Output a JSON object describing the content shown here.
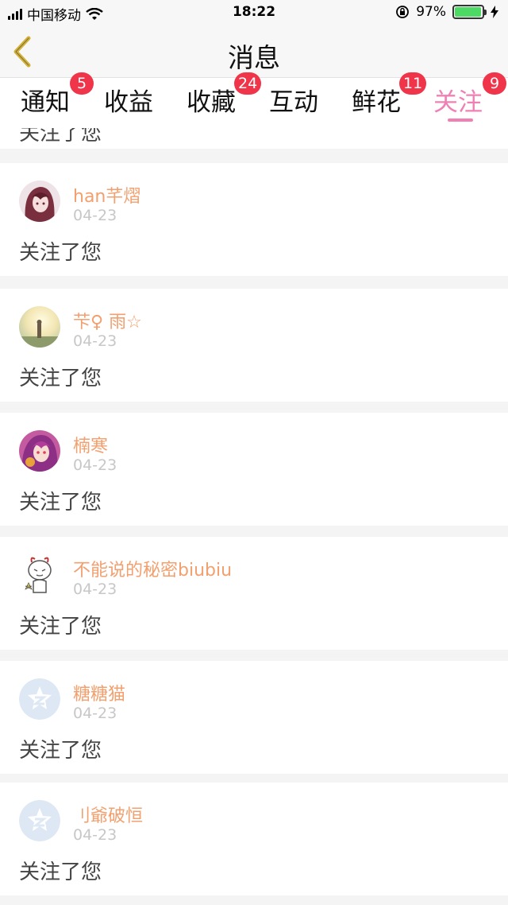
{
  "status_bar": {
    "carrier": "中国移动",
    "time": "18:22",
    "battery_percent": "97%",
    "battery_level": 0.97,
    "icons": [
      "signal-icon",
      "wifi-icon",
      "rotation-lock-icon",
      "battery-icon",
      "charging-icon"
    ]
  },
  "nav": {
    "title": "消息",
    "back_icon": "chevron-left-icon",
    "back_color": "#d4b23a"
  },
  "tabs": [
    {
      "label": "通知",
      "badge": "5"
    },
    {
      "label": "收益",
      "badge": ""
    },
    {
      "label": "收藏",
      "badge": "24"
    },
    {
      "label": "互动",
      "badge": ""
    },
    {
      "label": "鲜花",
      "badge": "11"
    },
    {
      "label": "关注",
      "badge": "9",
      "active": true
    }
  ],
  "colors": {
    "accent": "#f080b4",
    "badge": "#f0354b",
    "username": "#f2a06f",
    "date": "#c7c7c7"
  },
  "partial_item": {
    "text": "关注了您"
  },
  "items": [
    {
      "name": "han芊熠",
      "date": "04-23",
      "text": "关注了您",
      "avatar": "anime-girl-avatar"
    },
    {
      "name": "芐♀ 雨☆",
      "date": "04-23",
      "text": "关注了您",
      "avatar": "sunset-avatar"
    },
    {
      "name": "楠寒",
      "date": "04-23",
      "text": "关注了您",
      "avatar": "anime-purple-avatar"
    },
    {
      "name": "不能说的秘密biubiu",
      "date": "04-23",
      "text": "关注了您",
      "avatar": "cartoon-bunny-avatar"
    },
    {
      "name": "糖糖猫",
      "date": "04-23",
      "text": "关注了您",
      "avatar": "default-avatar"
    },
    {
      "name": "刂爺破恒",
      "date": "04-23",
      "text": "关注了您",
      "avatar": "default-avatar"
    }
  ]
}
